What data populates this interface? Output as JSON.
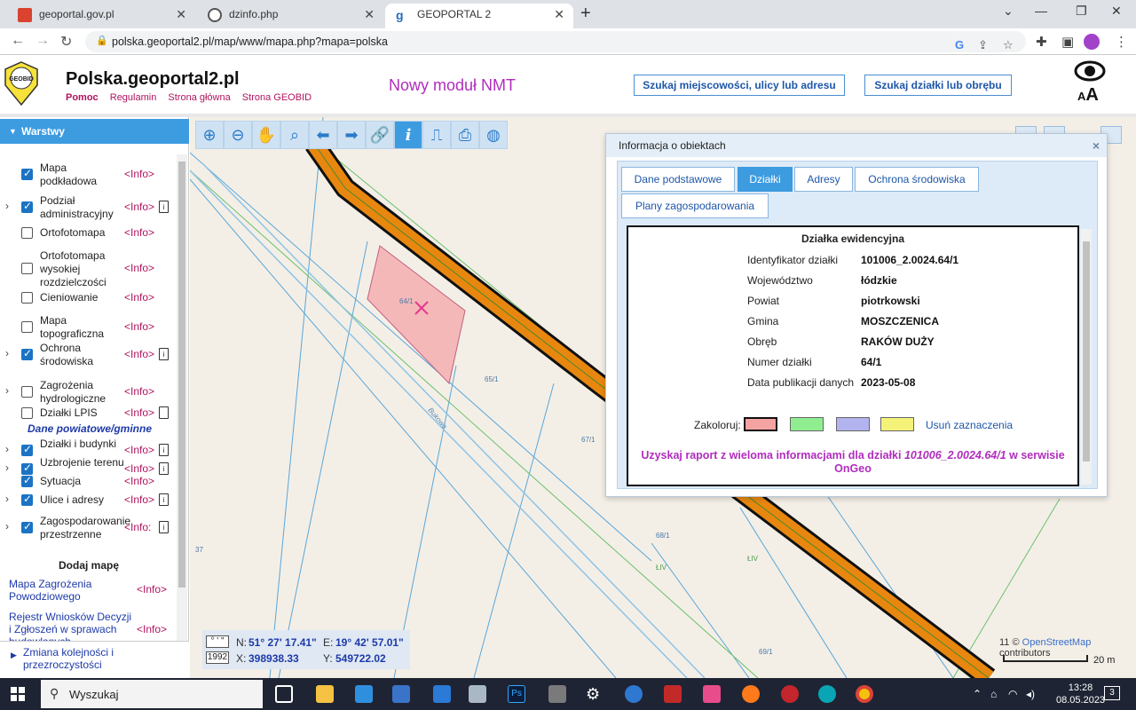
{
  "browser": {
    "tabs": [
      {
        "title": "geoportal.gov.pl"
      },
      {
        "title": "dzinfo.php"
      },
      {
        "title": "GEOPORTAL 2"
      }
    ],
    "url": "polska.geoportal2.pl/map/www/mapa.php?mapa=polska"
  },
  "header": {
    "logo_text": "GEOBID",
    "site_title": "Polska.geoportal2.pl",
    "links": [
      "Pomoc",
      "Regulamin",
      "Strona główna",
      "Strona GEOBID"
    ],
    "nmt": "Nowy moduł NMT",
    "search_address_btn": "Szukaj miejscowości, ulicy lub adresu",
    "search_parcel_btn": "Szukaj działki lub obrębu",
    "accessibility": "AA"
  },
  "layers_panel": {
    "title": "Warstwy",
    "info_label": "<Info>",
    "info_label_short": "<Info:",
    "layers": [
      {
        "name": "Mapa podkładowa",
        "checked": true
      },
      {
        "name": "Podział administracyjny",
        "checked": true
      },
      {
        "name": "Ortofotomapa",
        "checked": false
      },
      {
        "name": "Ortofotomapa wysokiej rozdzielczości",
        "checked": false
      },
      {
        "name": "Cieniowanie",
        "checked": false
      },
      {
        "name": "Mapa topograficzna",
        "checked": false
      },
      {
        "name": "Ochrona środowiska",
        "checked": true
      },
      {
        "name": "Zagrożenia hydrologiczne",
        "checked": false
      },
      {
        "name": "Działki LPIS",
        "checked": false
      },
      {
        "name": "Działki i budynki",
        "checked": true
      },
      {
        "name": "Uzbrojenie terenu",
        "checked": true
      },
      {
        "name": "Sytuacja",
        "checked": true
      },
      {
        "name": "Ulice i adresy",
        "checked": true
      },
      {
        "name": "Zagospodarowanie przestrzenne",
        "checked": true
      }
    ],
    "group_label": "Dane powiatowe/gminne",
    "add_map_title": "Dodaj mapę",
    "add_maps": [
      "Mapa Zagrożenia Powodziowego",
      "Rejestr Wniosków Decyzji i Zgłoszeń w sprawach budowlanych"
    ],
    "footer": "Zmiana kolejności i przezroczystości"
  },
  "map": {
    "coords": {
      "unit_label": "° ' \"",
      "system_label": "1992",
      "n_label": "N:",
      "n_value": "51° 27' 17.41\"",
      "e_label": "E:",
      "e_value": "19° 42' 57.01\"",
      "x_label": "X:",
      "x_value": "398938.33",
      "y_label": "Y:",
      "y_value": "549722.02"
    },
    "parcel_labels": [
      "64/1",
      "65/1",
      "67/1",
      "68/1",
      "69/1",
      "37",
      "ŁIV",
      "ŁIV"
    ],
    "street_label": "Bukowa",
    "attribution_link": "OpenStreetMap",
    "attribution_text": "contributors",
    "attribution_prefix": "11",
    "scale": "20 m"
  },
  "dialog": {
    "title": "Informacja o obiektach",
    "tabs": [
      "Dane podstawowe",
      "Działki",
      "Adresy",
      "Ochrona środowiska",
      "Plany zagospodarowania"
    ],
    "active_tab": "Działki",
    "section_title": "Działka ewidencyjna",
    "rows": [
      {
        "label": "Identyfikator działki",
        "value": "101006_2.0024.64/1"
      },
      {
        "label": "Województwo",
        "value": "łódzkie"
      },
      {
        "label": "Powiat",
        "value": "piotrkowski"
      },
      {
        "label": "Gmina",
        "value": "MOSZCZENICA"
      },
      {
        "label": "Obręb",
        "value": "RAKÓW DUŻY"
      },
      {
        "label": "Numer działki",
        "value": "64/1"
      },
      {
        "label": "Data publikacji danych",
        "value": "2023-05-08"
      }
    ],
    "color_label": "Zakoloruj:",
    "swatches": [
      "#f4a3a3",
      "#90ee90",
      "#b3b3f0",
      "#f5f27a"
    ],
    "clear_label": "Usuń zaznaczenia",
    "report_prefix": "Uzyskaj raport z wieloma informacjami dla działki ",
    "report_id": "101006_2.0024.64/1",
    "report_suffix": " w serwisie OnGeo"
  },
  "taskbar": {
    "search_placeholder": "Wyszukaj",
    "time": "13:28",
    "date": "08.05.2023",
    "notifications": "3"
  },
  "colors": {
    "accent": "#3d9be0",
    "road": "#e8870f",
    "parcel_fill": "#f4b8b8",
    "magenta": "#b02dbd"
  }
}
